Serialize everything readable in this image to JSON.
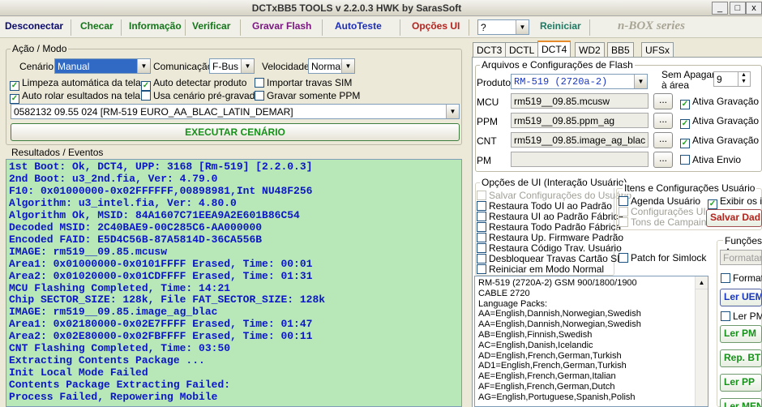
{
  "window": {
    "title": "DCTxBB5 TOOLS v 2.2.0.3 HWK by SarasSoft"
  },
  "menu": {
    "desconectar": "Desconectar",
    "checar": "Checar",
    "informacao": "Informação",
    "verificar": "Verificar",
    "gravar_flash": "Gravar Flash",
    "autoteste": "AutoTeste",
    "opcoes_ui": "Opções UI",
    "help_value": "?",
    "reiniciar": "Reiniciar",
    "brand": "n-BOX series"
  },
  "acao": {
    "group_label": "Ação / Modo",
    "cenario_label": "Cenário",
    "cenario_value": "Manual",
    "comunicacao_label": "Comunicação",
    "comunicacao_value": "F-Bus",
    "velocidade_label": "Velocidade",
    "velocidade_value": "Normal",
    "checks": {
      "limpeza": "Limpeza automática da tela",
      "auto_detectar": "Auto detectar produto",
      "importar": "Importar travas SIM",
      "auto_rolar": "Auto rolar esultados na tela",
      "usa_cenario": "Usa cenário pré-gravado",
      "gravar_ppm": "Gravar somente PPM"
    },
    "product_select": "0582132 09.55 024  [RM-519 EURO_AA_BLAC_LATIN_DEMAR]",
    "executar": "EXECUTAR CENÁRIO"
  },
  "resultados": {
    "label": "Resultados / Eventos",
    "lines": [
      "1st Boot: Ok, DCT4, UPP: 3168 [Rm-519] [2.2.0.3]",
      "2nd Boot: u3_2nd.fia, Ver: 4.79.0",
      "F10: 0x01000000-0x02FFFFFF,00898981,Int NU48F256",
      "Algorithm: u3_intel.fia, Ver: 4.80.0",
      "Algorithm Ok, MSID: 84A1607C71EEA9A2E601B86C54",
      "Decoded MSID: 2C40BAE9-00C285C6-AA000000",
      "Encoded FAID: E5D4C56B-87A5814D-36CA556B",
      "IMAGE: rm519__09.85.mcusw",
      "Area1: 0x01000000-0x0101FFFF Erased, Time: 00:01",
      "Area2: 0x01020000-0x01CDFFFF Erased, Time: 01:31",
      "MCU Flashing Completed, Time: 14:21",
      "Chip SECTOR_SIZE: 128k, File FAT_SECTOR_SIZE: 128k",
      "IMAGE: rm519__09.85.image_ag_blac",
      "Area1: 0x02180000-0x02E7FFFF Erased, Time: 01:47",
      "Area2: 0x02E80000-0x02FBFFFF Erased, Time: 00:11",
      "CNT Flashing Completed, Time: 03:50",
      "Extracting Contents Package ...",
      "Init Local Mode Failed",
      "Contents Package Extracting Failed:",
      "Process Failed, Repowering Mobile"
    ]
  },
  "tabs": [
    "DCT3",
    "DCTL",
    "DCT4",
    "WD2",
    "BB5",
    "UFSx"
  ],
  "arquivos": {
    "group_label": "Arquivos e Configurações de Flash",
    "produto_label": "Produto",
    "produto_value": "RM-519  (2720a-2)",
    "sem_apagar": "Sem Apagar",
    "a_area": "à área",
    "spin_value": "9",
    "mcu_label": "MCU",
    "mcu_value": "rm519__09.85.mcusw",
    "ppm_label": "PPM",
    "ppm_value": "rm519__09.85.ppm_ag",
    "cnt_label": "CNT",
    "cnt_value": "rm519__09.85.image_ag_blac",
    "pm_label": "PM",
    "pm_value": "",
    "browse": "...",
    "ativa_gravacao": "Ativa Gravação",
    "ativa_envio": "Ativa Envio"
  },
  "opcoes": {
    "group_label": "Opções de UI (Interação Usuário)",
    "items": [
      "Salvar Configurações do Usuário",
      "Restaura Todo UI ao Padrão",
      "Restaura UI ao Padrão Fábrica",
      "Restaura Todo Padrão Fábrica",
      "Restaura Up. Firmware Padrão",
      "Restaura Código Trav. Usuário",
      "Desbloquear Travas Cartão SIM",
      "Reiniciar em Modo Normal"
    ],
    "patch": "Patch for Simlock"
  },
  "itens": {
    "group_label": "Itens e Configurações Usuário",
    "agenda": "Agenda Usuário",
    "exibir": "Exibir os ite",
    "config_ui": "Configurações UI",
    "tons": "Tons de Campain",
    "salvar": "Salvar Dad"
  },
  "funcoes": {
    "label": "Funções A",
    "formatar": "Formatar",
    "format_chk": "Format",
    "ler_uem": "Ler UEM",
    "ler_pm_chk": "Ler PM",
    "ler_pm": "Ler PM",
    "rep_bt": "Rep. BT",
    "ler_pp": "Ler PP",
    "ler_men": "Ler MEN"
  },
  "info": {
    "lines": [
      "RM-519 (2720A-2) GSM 900/1800/1900",
      "CABLE 2720",
      "Language Packs:",
      "AA=English,Dannish,Norwegian,Swedish",
      "AA=English,Dannish,Norwegian,Swedish",
      "AB=English,Finnish,Swedish",
      "AC=English,Danish,Icelandic",
      "AD=English,French,German,Turkish",
      "AD1=English,French,German,Turkish",
      "AE=English,French,German,Italian",
      "AF=English,French,German,Dutch",
      "AG=English,Portuguese,Spanish,Polish"
    ]
  }
}
